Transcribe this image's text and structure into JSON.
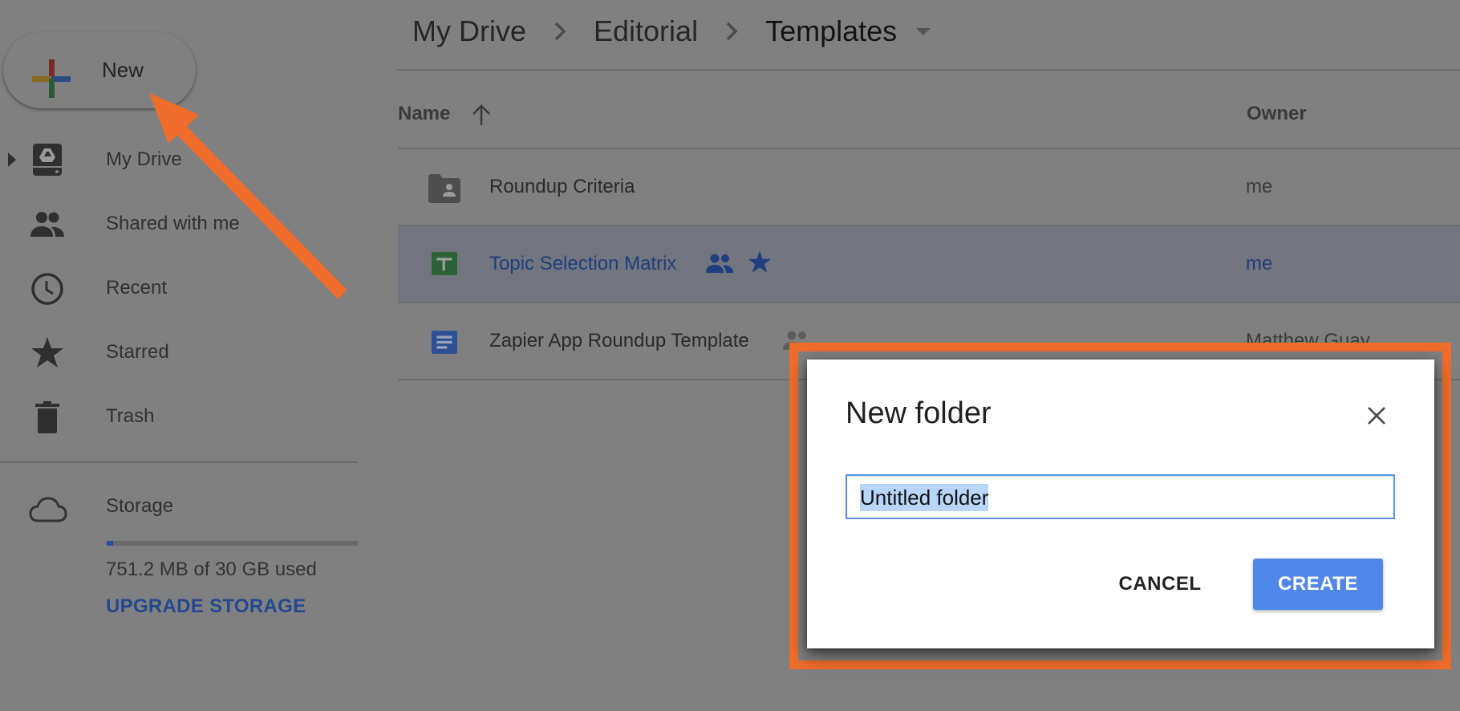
{
  "new_button": {
    "label": "New"
  },
  "sidebar": {
    "items": [
      {
        "label": "My Drive",
        "icon": "drive-icon",
        "expandable": true
      },
      {
        "label": "Shared with me",
        "icon": "shared-people-icon"
      },
      {
        "label": "Recent",
        "icon": "clock-icon"
      },
      {
        "label": "Starred",
        "icon": "star-icon"
      },
      {
        "label": "Trash",
        "icon": "trash-icon"
      }
    ],
    "storage": {
      "label": "Storage",
      "icon": "cloud-icon",
      "usage_text": "751.2 MB of 30 GB used",
      "used_fraction": 0.025,
      "upgrade_label": "UPGRADE STORAGE"
    }
  },
  "breadcrumb": {
    "items": [
      "My Drive",
      "Editorial",
      "Templates"
    ],
    "separator_icon": "chevron-right-icon",
    "dropdown_icon": "caret-down-icon"
  },
  "file_list": {
    "columns": {
      "name": "Name",
      "owner": "Owner",
      "sort": "ascending"
    },
    "rows": [
      {
        "name": "Roundup Criteria",
        "type": "shared-folder",
        "owner": "me",
        "shared": false,
        "starred": false,
        "selected": false
      },
      {
        "name": "Topic Selection Matrix",
        "type": "spreadsheet",
        "owner": "me",
        "shared": true,
        "starred": true,
        "selected": true
      },
      {
        "name": "Zapier App Roundup Template",
        "type": "document",
        "owner": "Matthew Guay",
        "shared": true,
        "starred": false,
        "selected": false
      }
    ]
  },
  "dialog": {
    "title": "New folder",
    "input_value": "Untitled folder",
    "input_selected": true,
    "cancel_label": "CANCEL",
    "create_label": "CREATE"
  },
  "annotations": {
    "arrow_color": "#EF6C2A",
    "frame_color": "#EF6C2A",
    "arrow_target": "new-button",
    "frame_target": "new-folder-dialog"
  },
  "colors": {
    "overlay_bg": "#808080",
    "selected_row": "#72757E",
    "primary_button": "#5287EA",
    "link_blue": "#23488f",
    "sheets_green": "#2A6136",
    "docs_blue": "#2C4F97"
  }
}
